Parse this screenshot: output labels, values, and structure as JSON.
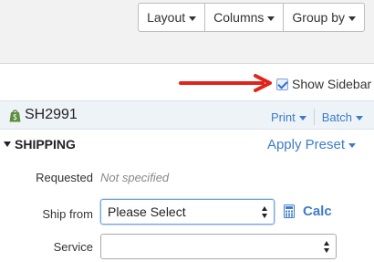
{
  "toolbar": {
    "layout_label": "Layout",
    "columns_label": "Columns",
    "group_by_label": "Group by"
  },
  "sidebar_toggle": {
    "label": "Show Sidebar",
    "checked": true
  },
  "annotation": {
    "arrow_color": "#e0241b"
  },
  "order": {
    "id": "SH2991",
    "icon": "shopify-bag-icon",
    "print_label": "Print",
    "batch_label": "Batch"
  },
  "shipping": {
    "title": "SHIPPING",
    "apply_preset_label": "Apply Preset",
    "requested_label": "Requested",
    "requested_value": "Not specified",
    "ship_from_label": "Ship from",
    "ship_from_value": "Please Select",
    "calc_label": "Calc",
    "service_label": "Service",
    "service_value": ""
  },
  "colors": {
    "accent": "#3d7cc9",
    "shopify_green": "#5e8e3e"
  }
}
